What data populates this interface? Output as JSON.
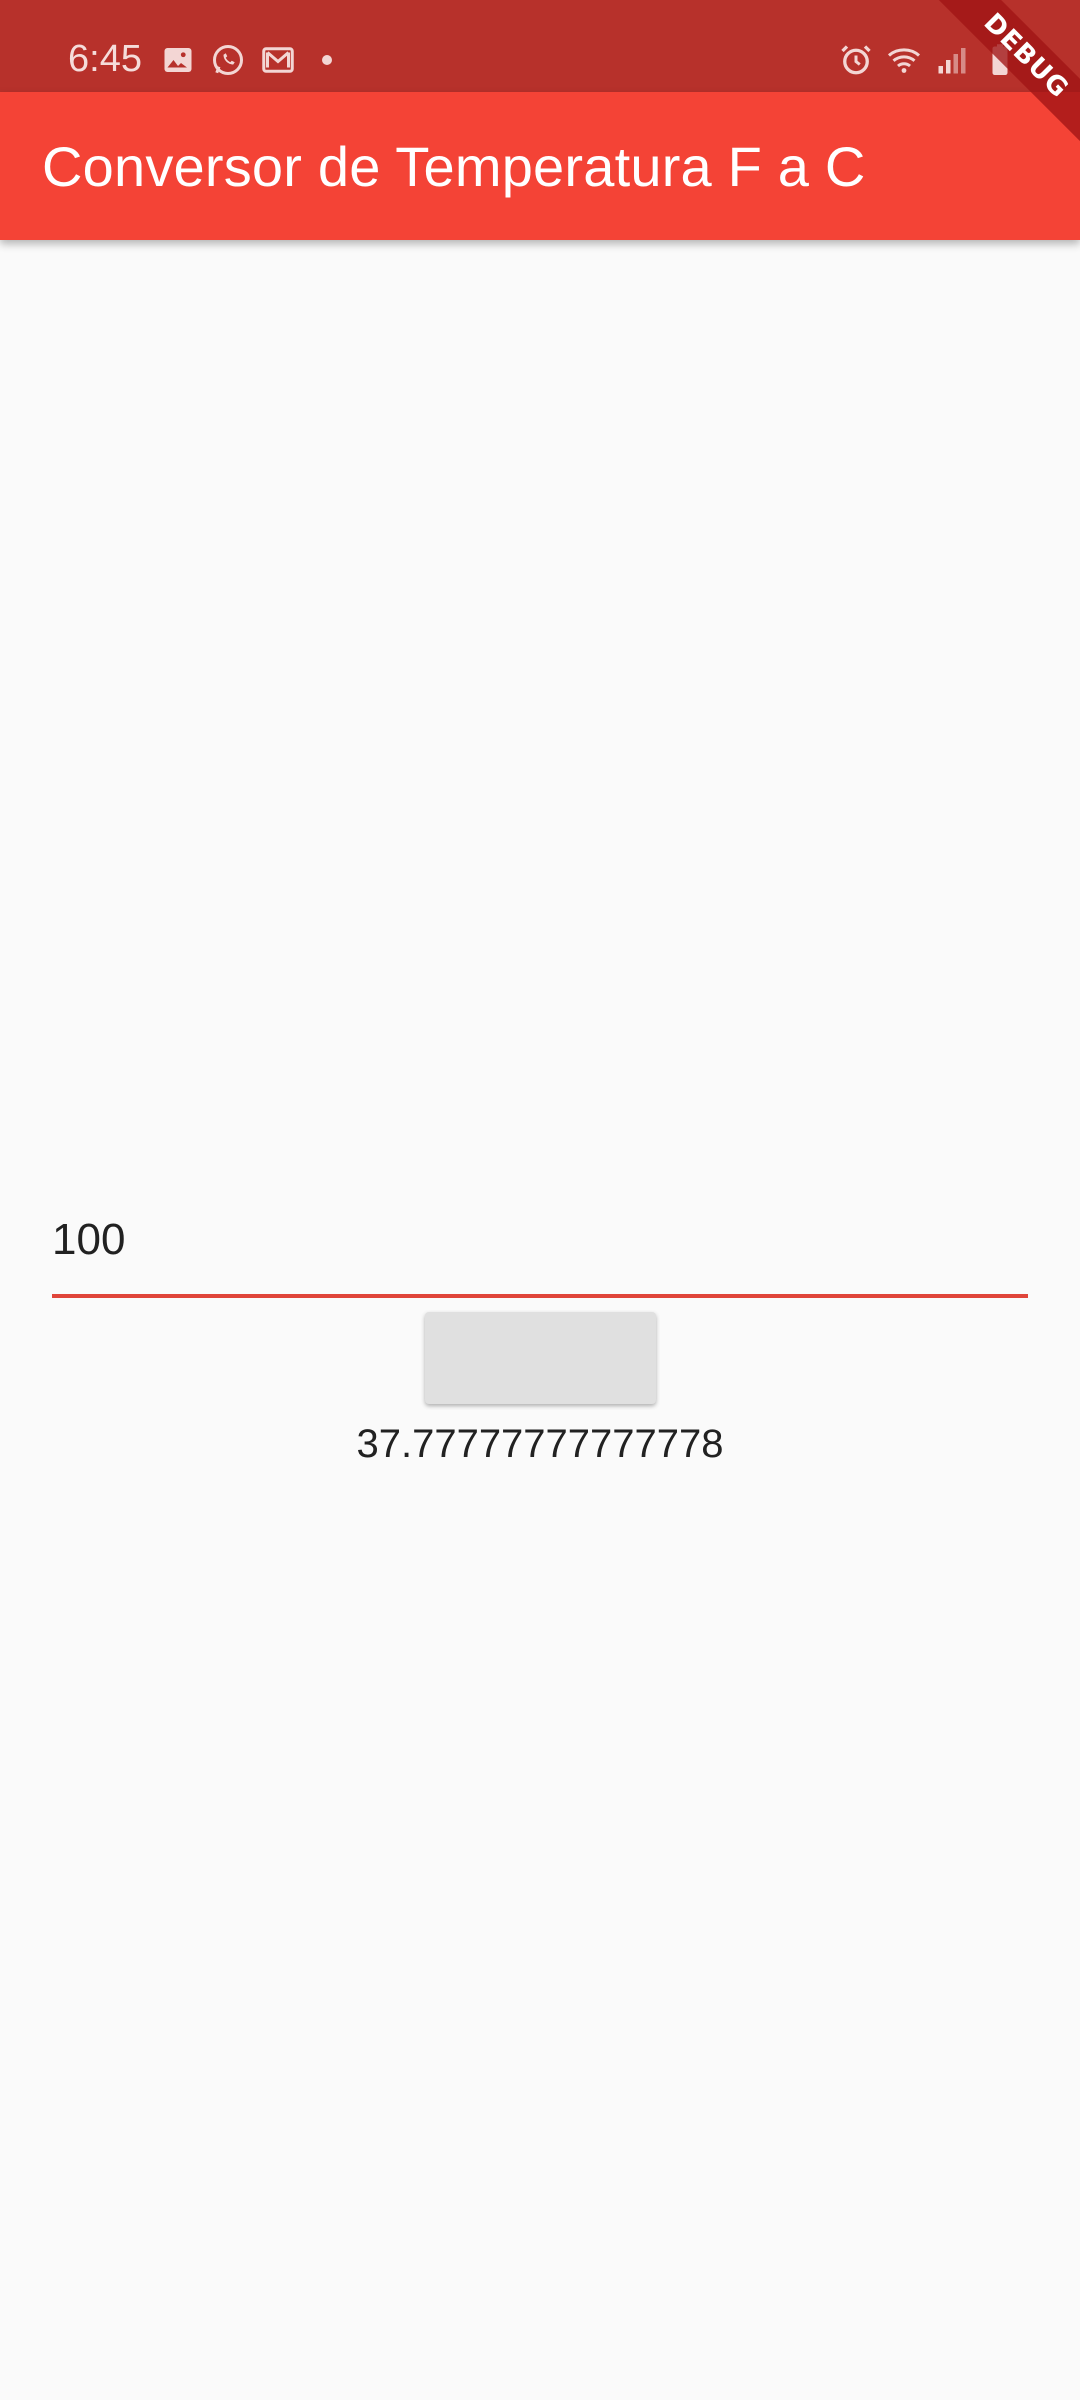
{
  "status_bar": {
    "time": "6:45",
    "left_icons": [
      "image-icon",
      "whatsapp-icon",
      "gmail-icon",
      "notification-dot"
    ],
    "right_icons": [
      "alarm-icon",
      "wifi-icon",
      "signal-icon",
      "battery-icon"
    ]
  },
  "debug_banner": {
    "label": "DEBUG"
  },
  "app_bar": {
    "title": "Conversor de Temperatura F a C"
  },
  "form": {
    "temperature_value": "100",
    "convert_button_label": ""
  },
  "result": {
    "value": "37.77777777777778"
  },
  "colors": {
    "status_bar": "#b7312b",
    "app_bar": "#f44336",
    "accent": "#e0453a",
    "background": "#fafafa",
    "button": "#e0e0e0"
  }
}
